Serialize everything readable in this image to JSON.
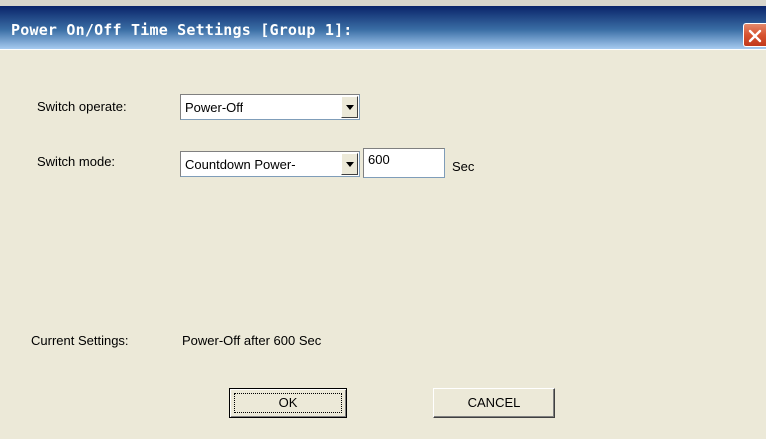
{
  "window": {
    "title": "Power On/Off Time Settings [Group 1]:"
  },
  "form": {
    "switch_operate": {
      "label": "Switch operate:",
      "selected": "Power-Off"
    },
    "switch_mode": {
      "label": "Switch  mode:",
      "selected": "Countdown Power-",
      "seconds_value": "600",
      "unit": "Sec"
    },
    "current_settings": {
      "label": "Current Settings:",
      "value": "Power-Off after 600 Sec"
    }
  },
  "buttons": {
    "ok_label": "OK",
    "cancel_label": "CANCEL"
  },
  "colors": {
    "dialog_bg": "#ece9d8",
    "titlebar": "#0a246a",
    "close_button": "#d7532f"
  },
  "icons": {
    "close": "close-icon",
    "dropdown": "chevron-down-icon"
  }
}
